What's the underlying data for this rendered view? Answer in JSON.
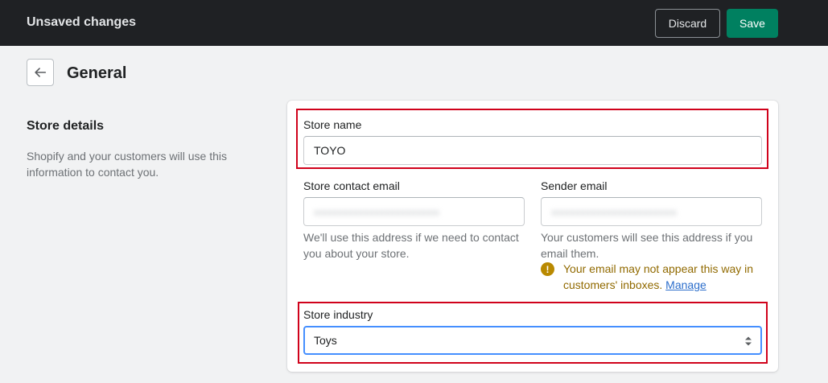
{
  "topbar": {
    "title": "Unsaved changes",
    "discard_label": "Discard",
    "save_label": "Save"
  },
  "page": {
    "title": "General"
  },
  "store_details": {
    "title": "Store details",
    "description": "Shopify and your customers will use this information to contact you."
  },
  "form": {
    "store_name": {
      "label": "Store name",
      "value": "TOYO"
    },
    "contact_email": {
      "label": "Store contact email",
      "help": "We'll use this address if we need to contact you about your store."
    },
    "sender_email": {
      "label": "Sender email",
      "help": "Your customers will see this address if you email them."
    },
    "warning": {
      "text": "Your email may not appear this way in customers' inboxes.",
      "link": "Manage"
    },
    "store_industry": {
      "label": "Store industry",
      "value": "Toys"
    }
  },
  "colors": {
    "topbar_bg": "#1f2124",
    "save_button": "#008060",
    "highlight": "#d0021b",
    "warning": "#b98900",
    "link": "#2c6ecb",
    "focus": "#458fff"
  },
  "icons": {
    "back": "arrow-left-icon",
    "warning": "alert-circle-icon",
    "select": "select-arrows-icon"
  }
}
